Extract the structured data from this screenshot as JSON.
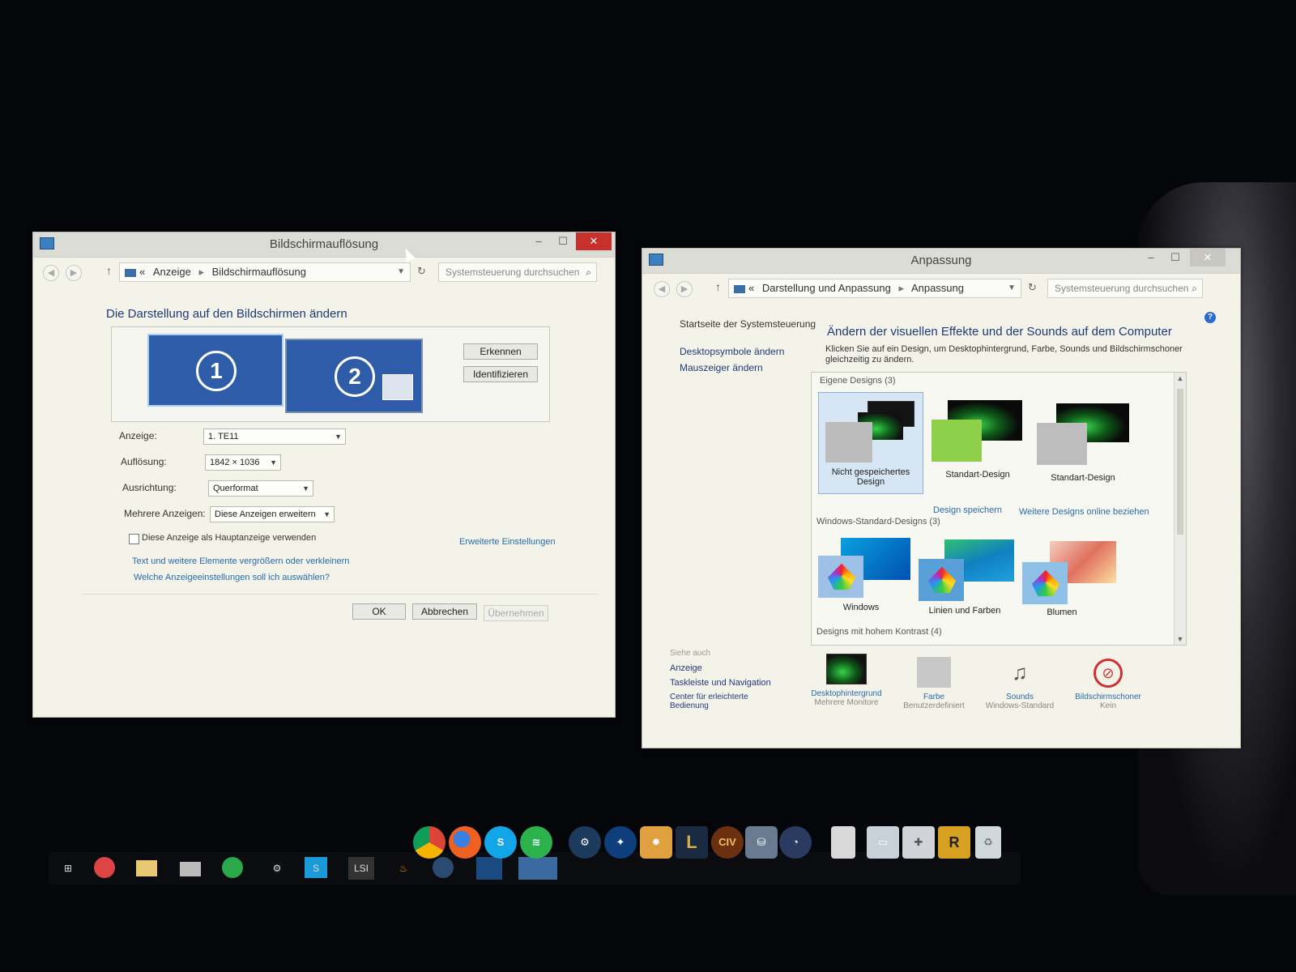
{
  "left_window": {
    "title": "Bildschirmauflösung",
    "breadcrumb": [
      "Anzeige",
      "Bildschirmauflösung"
    ],
    "breadcrumb_prefix": "«",
    "search_placeholder": "Systemsteuerung durchsuchen",
    "heading": "Die Darstellung auf den Bildschirmen ändern",
    "monitors": [
      "1",
      "2"
    ],
    "buttons": {
      "detect": "Erkennen",
      "identify": "Identifizieren",
      "ok": "OK",
      "cancel": "Abbrechen",
      "apply": "Übernehmen"
    },
    "fields": {
      "display_label": "Anzeige:",
      "display_value": "1. TE11",
      "resolution_label": "Auflösung:",
      "resolution_value": "1842 × 1036",
      "orientation_label": "Ausrichtung:",
      "orientation_value": "Querformat",
      "multi_label": "Mehrere Anzeigen:",
      "multi_value": "Diese Anzeigen erweitern"
    },
    "checkbox_label": "Diese Anzeige als Hauptanzeige verwenden",
    "advanced_link": "Erweiterte Einstellungen",
    "links": [
      "Text und weitere Elemente vergrößern oder verkleinern",
      "Welche Anzeigeeinstellungen soll ich auswählen?"
    ]
  },
  "right_window": {
    "title": "Anpassung",
    "breadcrumb": [
      "Darstellung und Anpassung",
      "Anpassung"
    ],
    "breadcrumb_prefix": "«",
    "search_placeholder": "Systemsteuerung durchsuchen",
    "help": "?",
    "sidebar": [
      "Startseite der Systemsteuerung",
      "Desktopsymbole ändern",
      "Mauszeiger ändern"
    ],
    "see_also_title": "Siehe auch",
    "see_also": [
      "Anzeige",
      "Taskleiste und Navigation",
      "Center für erleichterte Bedienung"
    ],
    "heading": "Ändern der visuellen Effekte und der Sounds auf dem Computer",
    "description": "Klicken Sie auf ein Design, um Desktophintergrund, Farbe, Sounds und Bildschirmschoner gleichzeitig zu ändern.",
    "my_themes_title": "Eigene Designs (3)",
    "my_themes": [
      "Nicht gespeichertes Design",
      "Standart-Design",
      "Standart-Design"
    ],
    "save_theme": "Design speichern",
    "more_online": "Weitere Designs online beziehen",
    "windows_themes_title": "Windows-Standard-Designs (3)",
    "windows_themes": [
      "Windows",
      "Linien und Farben",
      "Blumen"
    ],
    "high_contrast_title": "Designs mit hohem Kontrast (4)",
    "bottom": [
      {
        "label": "Desktophintergrund",
        "sub": "Mehrere Monitore"
      },
      {
        "label": "Farbe",
        "sub": "Benutzerdefiniert"
      },
      {
        "label": "Sounds",
        "sub": "Windows-Standard"
      },
      {
        "label": "Bildschirmschoner",
        "sub": "Kein"
      }
    ]
  },
  "dock": {
    "icons": [
      "chrome-icon",
      "firefox-icon",
      "skype-icon",
      "spotify-icon",
      "steam-icon",
      "battle-net-icon",
      "game-icon",
      "league-icon",
      "civ-icon",
      "network-icon",
      "clock-icon",
      "document-icon",
      "folder-icon",
      "puzzle-icon",
      "rockstar-icon",
      "trash-icon"
    ],
    "league_label": "L",
    "civ_label": "CIV",
    "rockstar_label": "R"
  },
  "taskbar": {
    "lsi_label": "LSI"
  },
  "colors": {
    "accent": "#2a6aa8",
    "close": "#c8302c",
    "monitor": "#2e5ca8"
  }
}
